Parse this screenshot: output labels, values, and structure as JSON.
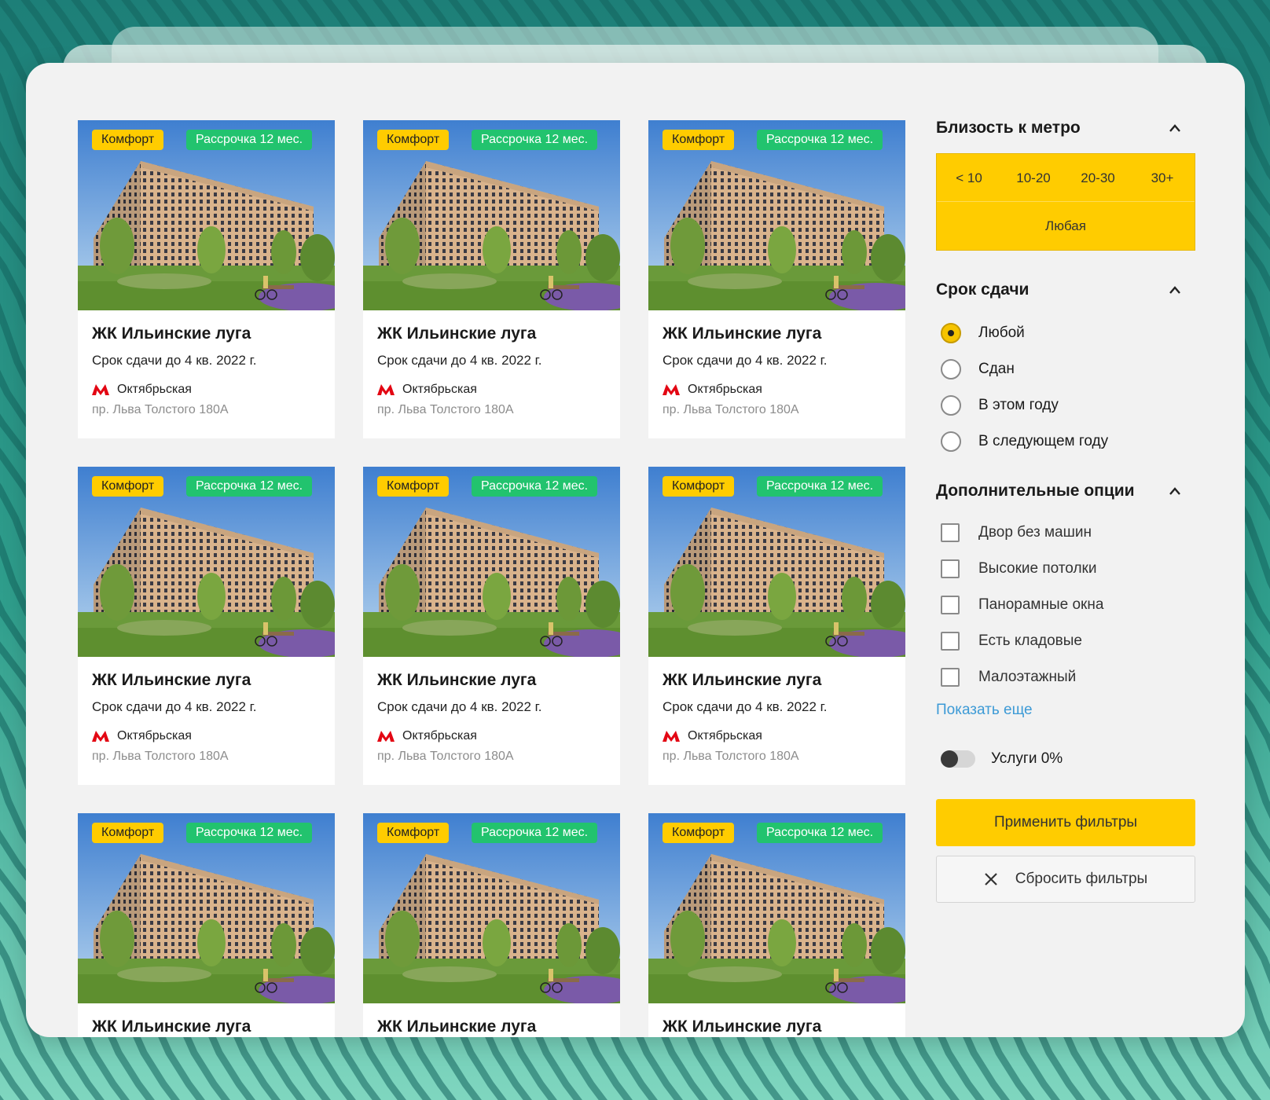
{
  "colors": {
    "accent_yellow": "#ffcc00",
    "badge_green": "#22c36e",
    "metro_red": "#e30613",
    "link_blue": "#3c9ad6"
  },
  "card": {
    "badge_class": "Комфорт",
    "badge_installment": "Рассрочка 12 мес.",
    "title": "ЖК Ильинские луга",
    "deadline": "Срок сдачи до 4 кв. 2022 г.",
    "metro_icon": "metro-m-icon",
    "metro": "Октябрьская",
    "address": "пр. Льва Толстого 180А"
  },
  "filters": {
    "metro_title": "Близость к метро",
    "metro_options": [
      "< 10",
      "10-20",
      "20-30",
      "30+"
    ],
    "metro_any": "Любая",
    "deadline_title": "Срок сдачи",
    "deadline_options": [
      "Любой",
      "Сдан",
      "В этом году",
      "В следующем году"
    ],
    "deadline_selected": "Любой",
    "options_title": "Дополнительные опции",
    "options": [
      "Двор без машин",
      "Высокие потолки",
      "Панорамные окна",
      "Есть кладовые",
      "Малоэтажный"
    ],
    "show_more": "Показать еще",
    "toggle_label": "Услуги 0%",
    "toggle_on": false,
    "apply_label": "Применить фильтры",
    "reset_label": "Сбросить фильтры"
  }
}
